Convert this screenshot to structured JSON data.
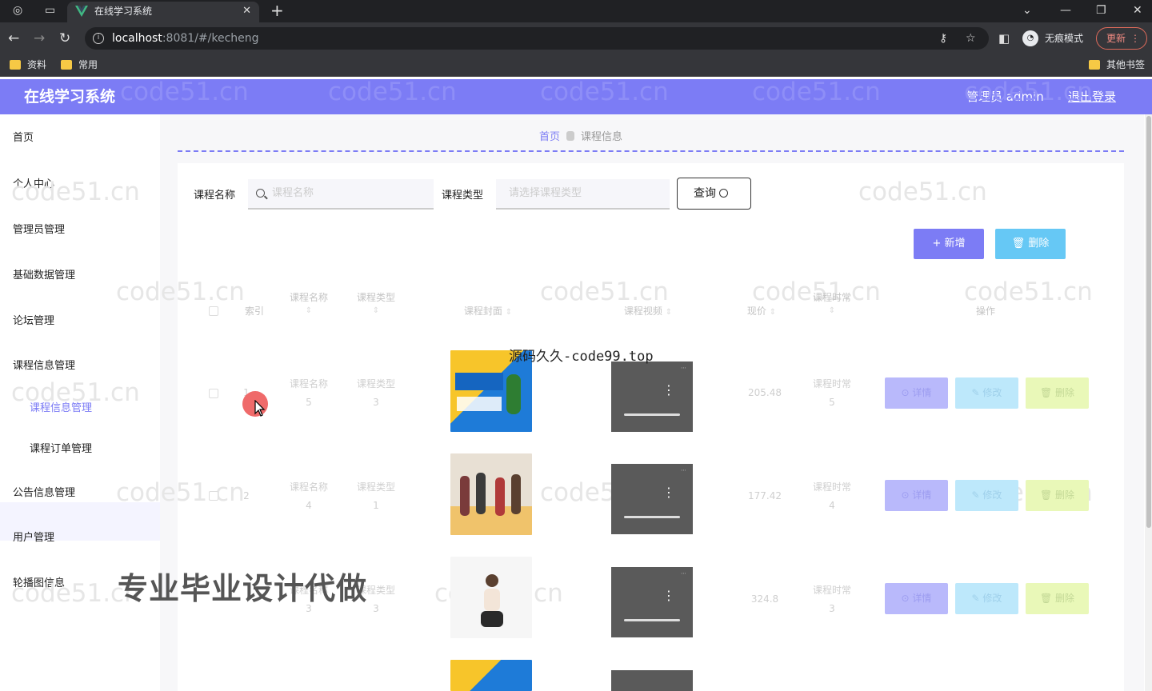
{
  "browser": {
    "tab_title": "在线学习系统",
    "url_host": "localhost",
    "url_rest": ":8081/#/kecheng",
    "incognito_label": "无痕模式",
    "update_label": "更新",
    "bookmarks": [
      "资料",
      "常用"
    ],
    "other_bookmarks": "其他书签"
  },
  "header": {
    "title": "在线学习系统",
    "user": "管理员 admin",
    "logout": "退出登录"
  },
  "sidebar": {
    "items": [
      {
        "label": "首页"
      },
      {
        "label": "个人中心"
      },
      {
        "label": "管理员管理"
      },
      {
        "label": "基础数据管理"
      },
      {
        "label": "论坛管理"
      },
      {
        "label": "课程信息管理"
      },
      {
        "label": "课程信息管理"
      },
      {
        "label": "课程订单管理"
      },
      {
        "label": "公告信息管理"
      },
      {
        "label": "用户管理"
      },
      {
        "label": "轮播图信息"
      }
    ]
  },
  "breadcrumb": {
    "home": "首页",
    "current": "课程信息"
  },
  "search": {
    "name_label": "课程名称",
    "name_placeholder": "课程名称",
    "type_label": "课程类型",
    "type_placeholder": "请选择课程类型",
    "query_label": "查询"
  },
  "actions": {
    "add": "新增",
    "delete": "删除"
  },
  "table": {
    "columns": [
      "索引",
      "课程名称",
      "课程类型",
      "课程封面",
      "课程视频",
      "现价",
      "课程时常",
      "操作"
    ],
    "rows": [
      {
        "index": "1",
        "name_label": "课程名称",
        "name_val": "5",
        "type_label": "课程类型",
        "type_val": "3",
        "price": "205.48",
        "dur_label": "课程时常",
        "dur_val": "5"
      },
      {
        "index": "2",
        "name_label": "课程名称",
        "name_val": "4",
        "type_label": "课程类型",
        "type_val": "1",
        "price": "177.42",
        "dur_label": "课程时常",
        "dur_val": "4"
      },
      {
        "index": "3",
        "name_label": "课程名称",
        "name_val": "3",
        "type_label": "课程类型",
        "type_val": "3",
        "price": "324.8",
        "dur_label": "课程时常",
        "dur_val": "3"
      }
    ],
    "row_actions": {
      "detail": "详情",
      "edit": "修改",
      "delete": "删除"
    }
  },
  "overlays": {
    "source": "源码久久-code99.top",
    "promo": "专业毕业设计代做",
    "watermark": "code51.cn"
  },
  "colors": {
    "primary": "#7c7cf5",
    "info": "#66c8f5"
  }
}
